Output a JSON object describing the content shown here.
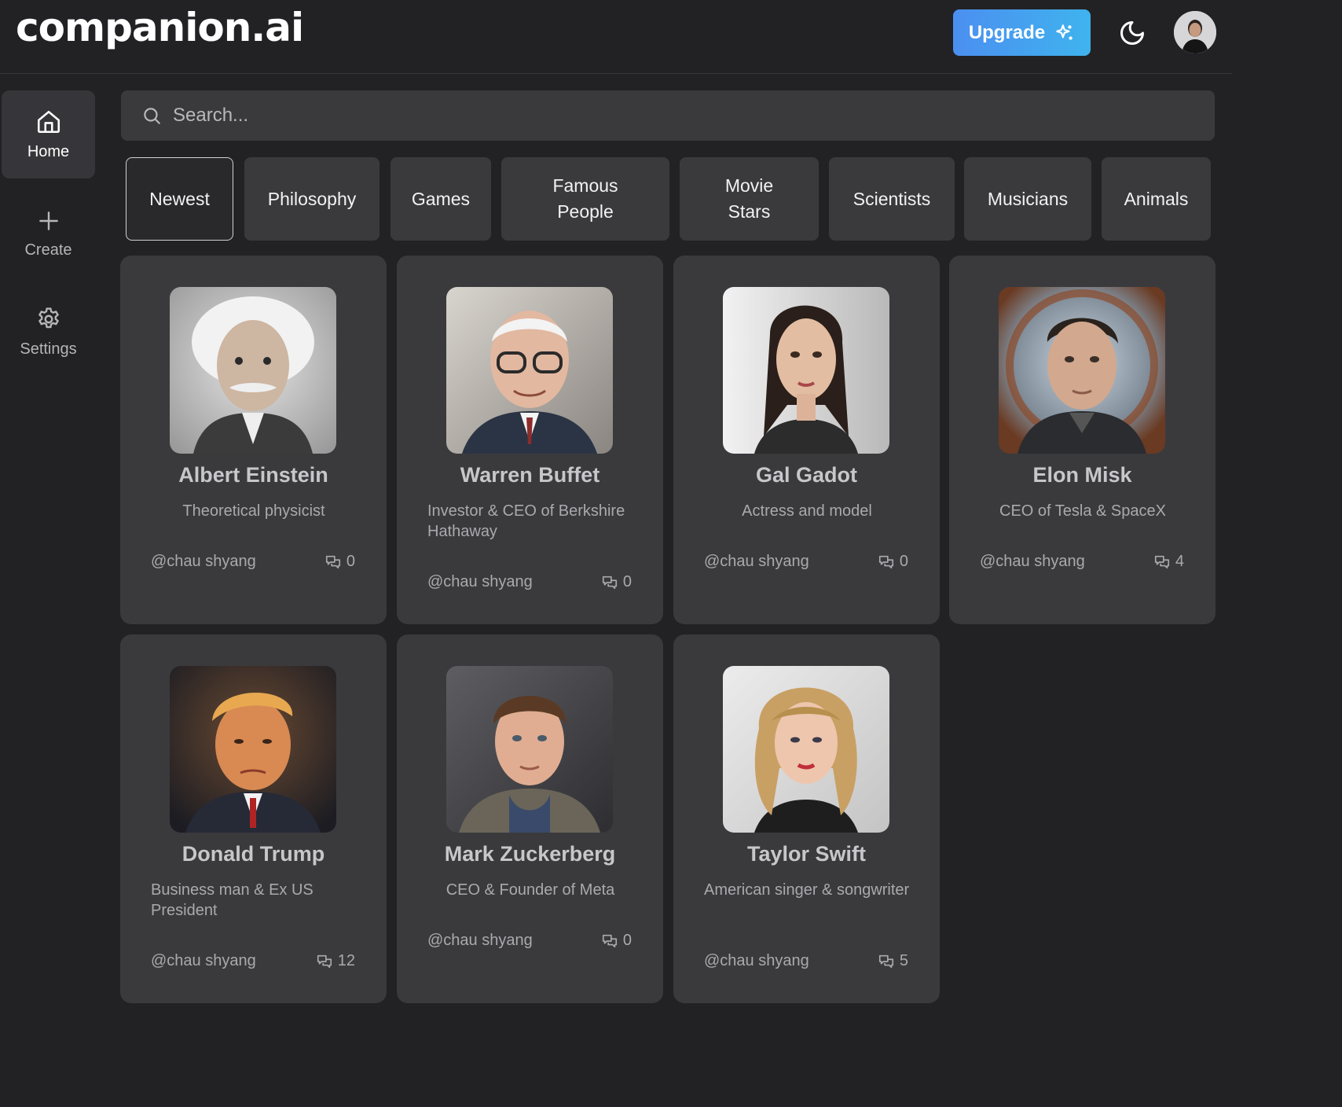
{
  "app": {
    "logo": "companion.ai"
  },
  "header": {
    "upgrade_label": "Upgrade"
  },
  "sidebar": {
    "items": [
      {
        "label": "Home",
        "icon": "home-icon"
      },
      {
        "label": "Create",
        "icon": "plus-icon"
      },
      {
        "label": "Settings",
        "icon": "gear-icon"
      }
    ]
  },
  "search": {
    "placeholder": "Search...",
    "value": ""
  },
  "categories": [
    {
      "label": "Newest"
    },
    {
      "label": "Philosophy"
    },
    {
      "label": "Games"
    },
    {
      "label": "Famous\nPeople"
    },
    {
      "label": "Movie\nStars"
    },
    {
      "label": "Scientists"
    },
    {
      "label": "Musicians"
    },
    {
      "label": "Animals"
    }
  ],
  "companions": [
    {
      "name": "Albert Einstein",
      "description": "Theoretical physicist",
      "author": "@chau shyang",
      "messages": "0"
    },
    {
      "name": "Warren Buffet",
      "description": "Investor & CEO of Berkshire Hathaway",
      "author": "@chau shyang",
      "messages": "0"
    },
    {
      "name": "Gal Gadot",
      "description": "Actress and model",
      "author": "@chau shyang",
      "messages": "0"
    },
    {
      "name": "Elon Misk",
      "description": "CEO of Tesla & SpaceX",
      "author": "@chau shyang",
      "messages": "4"
    },
    {
      "name": "Donald Trump",
      "description": "Business man & Ex US President",
      "author": "@chau shyang",
      "messages": "12"
    },
    {
      "name": "Mark Zuckerberg",
      "description": "CEO & Founder of Meta",
      "author": "@chau shyang",
      "messages": "0"
    },
    {
      "name": "Taylor Swift",
      "description": "American singer & songwriter",
      "author": "@chau shyang",
      "messages": "5"
    }
  ],
  "colors": {
    "accent_start": "#4b8ff0",
    "accent_end": "#3fb3ee",
    "background": "#222224",
    "card": "#3a3a3d"
  }
}
